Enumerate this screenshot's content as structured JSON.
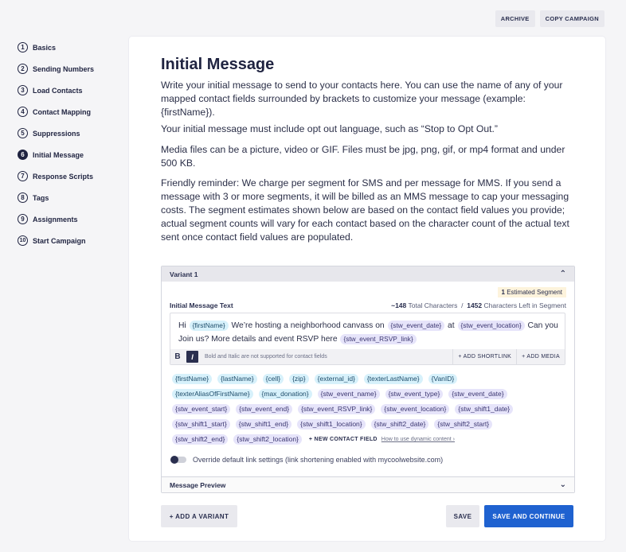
{
  "header": {
    "archive_label": "ARCHIVE",
    "copy_label": "COPY CAMPAIGN"
  },
  "sidebar": {
    "active_index": 5,
    "steps": [
      {
        "num": "1",
        "label": "Basics"
      },
      {
        "num": "2",
        "label": "Sending Numbers"
      },
      {
        "num": "3",
        "label": "Load Contacts"
      },
      {
        "num": "4",
        "label": "Contact Mapping"
      },
      {
        "num": "5",
        "label": "Suppressions"
      },
      {
        "num": "6",
        "label": "Initial Message"
      },
      {
        "num": "7",
        "label": "Response Scripts"
      },
      {
        "num": "8",
        "label": "Tags"
      },
      {
        "num": "9",
        "label": "Assignments"
      },
      {
        "num": "10",
        "label": "Start Campaign"
      }
    ]
  },
  "main": {
    "title": "Initial Message",
    "paragraphs": [
      "Write your initial message to send to your contacts here. You can use the name of any of your mapped contact fields surrounded by brackets to customize your message (example: {firstName}).",
      "Your initial message must include opt out language, such as “Stop to Opt Out.”",
      "Media files can be a picture, video or GIF. Files must be jpg, png, gif, or mp4 format and under 500 KB.",
      "Friendly reminder: We charge per segment for SMS and per message for MMS. If you send a message with 3 or more segments, it will be billed as an MMS message to cap your messaging costs. The segment estimates shown below are based on the contact field values you provide; actual segment counts will vary for each contact based on the character count of the actual text sent once contact field values are populated."
    ]
  },
  "variant": {
    "header": "Variant 1",
    "segments_count": "1",
    "segments_label": "Estimated Segment",
    "message_label": "Initial Message Text",
    "total_chars": "~148",
    "total_chars_label": "Total Characters",
    "separator": "/",
    "left_chars": "1452",
    "left_chars_label": "Characters Left in Segment",
    "message_parts": [
      {
        "t": "text",
        "v": "Hi "
      },
      {
        "t": "blue",
        "v": "{firstName}"
      },
      {
        "t": "text",
        "v": " We’re hosting a neighborhood canvass on "
      },
      {
        "t": "purple",
        "v": "{stw_event_date}"
      },
      {
        "t": "text",
        "v": " at "
      },
      {
        "t": "purple",
        "v": "{stw_event_location}"
      },
      {
        "t": "text",
        "v": " Can you Join us? More details and event RSVP here "
      },
      {
        "t": "purple",
        "v": "{stw_event_RSVP_link}"
      }
    ],
    "toolbar": {
      "bold": "B",
      "italic": "I",
      "note": "Bold and Italic are not supported for contact fields",
      "add_shortlink": "+ ADD SHORTLINK",
      "add_media": "+ ADD MEDIA"
    },
    "tag_rows": [
      [
        {
          "v": "{firstName}",
          "c": "blue"
        },
        {
          "v": "{lastName}",
          "c": "blue"
        },
        {
          "v": "{cell}",
          "c": "blue"
        },
        {
          "v": "{zip}",
          "c": "blue"
        },
        {
          "v": "{external_id}",
          "c": "blue"
        },
        {
          "v": "{texterLastName}",
          "c": "blue"
        },
        {
          "v": "{VanID}",
          "c": "blue"
        }
      ],
      [
        {
          "v": "{texterAliasOfFirstName}",
          "c": "blue"
        },
        {
          "v": "{max_donation}",
          "c": "blue"
        },
        {
          "v": "{stw_event_name}",
          "c": "purple"
        },
        {
          "v": "{stw_event_type}",
          "c": "purple"
        },
        {
          "v": "{stw_event_date}",
          "c": "purple"
        }
      ],
      [
        {
          "v": "{stw_event_start}",
          "c": "purple"
        },
        {
          "v": "{stw_event_end}",
          "c": "purple"
        },
        {
          "v": "{stw_event_RSVP_link}",
          "c": "purple"
        },
        {
          "v": "{stw_event_location}",
          "c": "purple"
        },
        {
          "v": "{stw_shift1_date}",
          "c": "purple"
        }
      ],
      [
        {
          "v": "{stw_shift1_start}",
          "c": "purple"
        },
        {
          "v": "{stw_shift1_end}",
          "c": "purple"
        },
        {
          "v": "{stw_shift1_location}",
          "c": "purple"
        },
        {
          "v": "{stw_shift2_date}",
          "c": "purple"
        },
        {
          "v": "{stw_shift2_start}",
          "c": "purple"
        }
      ],
      [
        {
          "v": "{stw_shift2_end}",
          "c": "purple"
        },
        {
          "v": "{stw_shift2_location}",
          "c": "purple"
        }
      ]
    ],
    "new_field_label": "+ NEW CONTACT FIELD",
    "howto_label": "How to use dynamic content ›",
    "override_label": "Override default link settings (link shortening enabled with mycoolwebsite.com)",
    "override_on": false,
    "preview_label": "Message Preview"
  },
  "actions": {
    "add_variant": "+ ADD A VARIANT",
    "save": "SAVE",
    "save_continue": "SAVE AND CONTINUE"
  },
  "colors": {
    "accent": "#1f62d0",
    "navy": "#1f2340",
    "chip_blue": "#d7f1fb",
    "chip_purple": "#e6e4fa"
  }
}
